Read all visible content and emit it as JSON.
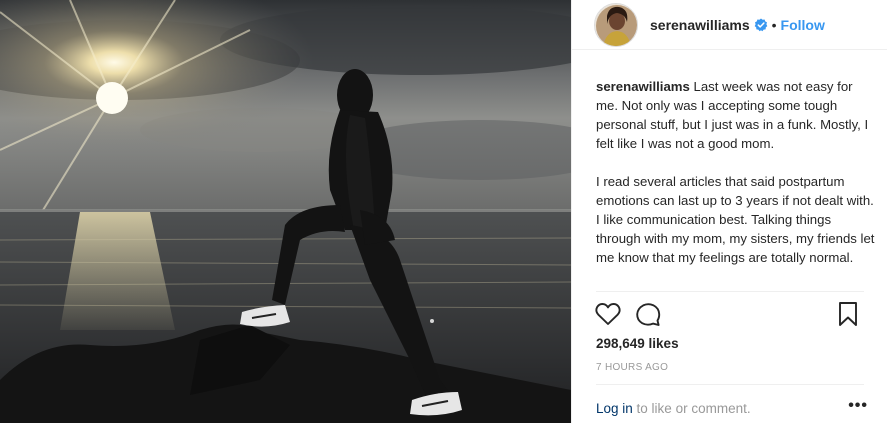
{
  "post": {
    "username": "serenawilliams",
    "dot": "•",
    "follow_label": "Follow",
    "caption": {
      "username": "serenawilliams",
      "paragraph1": "Last week was not easy for me. Not only was I accepting some tough personal stuff, but I just was in a funk. Mostly, I felt like I was not a good mom.",
      "paragraph2": "I read several articles that said postpartum emotions can last up to 3 years if not dealt with. I like communication best. Talking things through with my mom, my sisters, my friends let me know that my feelings are totally normal."
    },
    "likes": "298,649 likes",
    "time": "7 HOURS AGO",
    "footer": {
      "login_label": "Log in",
      "suffix": " to like or comment.",
      "more_label": "•••"
    }
  },
  "icons": {
    "verified": "verified-badge-icon",
    "like": "heart-icon",
    "comment": "comment-icon",
    "save": "bookmark-icon",
    "more": "more-options-icon"
  },
  "colors": {
    "follow": "#3897f0",
    "verified": "#3897f0",
    "login": "#003569",
    "muted": "#999999",
    "text": "#262626"
  }
}
